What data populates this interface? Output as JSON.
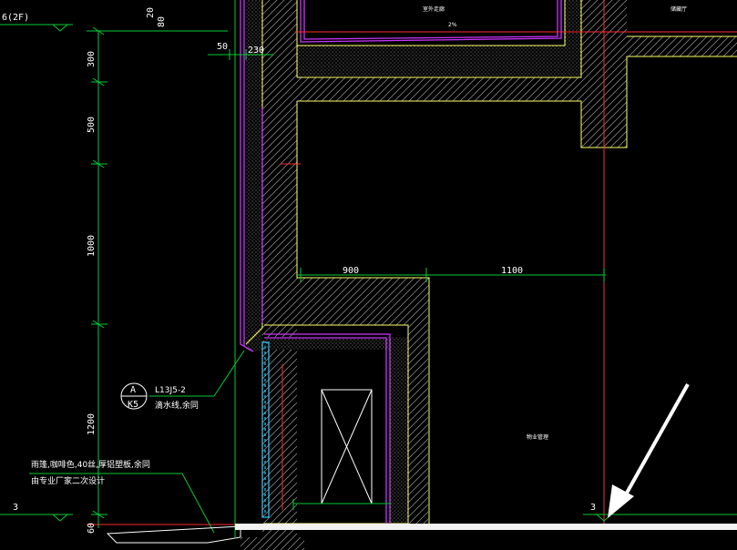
{
  "levels": {
    "upper": "6(2F)",
    "grid_left": "3",
    "grid_right": "3"
  },
  "left_dimensions": [
    "300",
    "500",
    "1000",
    "1200",
    "60"
  ],
  "top_dimensions": [
    "50",
    "230"
  ],
  "top_vertical_text": [
    "20",
    "80"
  ],
  "mid_dimensions": [
    "900",
    "1100"
  ],
  "room_labels": {
    "top_center": "室外走廊",
    "top_right": "储藏厅",
    "slope": "2%",
    "right_room": "物业管理"
  },
  "detail_callout": {
    "letter": "A",
    "sheet": "K5",
    "reference": "L13J5-2",
    "note": "滴水线,余同"
  },
  "canopy_note": {
    "line1": "雨篷,咖啡色,40丝,厚铝塑板,余同",
    "line2": "由专业厂家二次设计"
  },
  "colors": {
    "background": "#000000",
    "wall_outline": "#ffff66",
    "finish_line": "#cc33ff",
    "dimension": "#00cc33",
    "axis": "#ff2a2a",
    "glass": "#33ccff",
    "text": "#ffffff",
    "arrow": "#ffffff"
  }
}
